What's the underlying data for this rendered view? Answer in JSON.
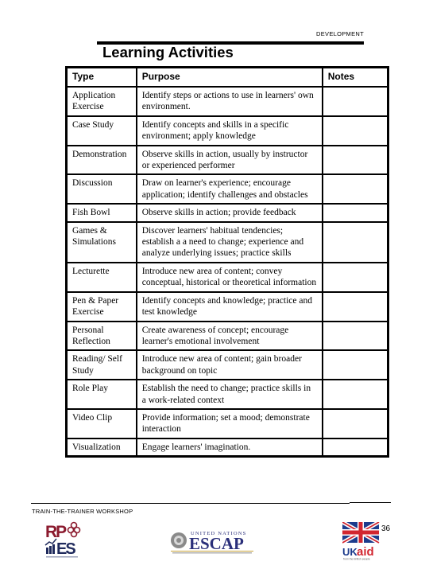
{
  "header": {
    "section_label": "DEVELOPMENT",
    "title": "Learning Activities"
  },
  "table": {
    "columns": [
      "Type",
      "Purpose",
      "Notes"
    ],
    "rows": [
      {
        "type": "Application Exercise",
        "purpose": "Identify steps or actions to use in learners' own environment.",
        "notes": ""
      },
      {
        "type": "Case Study",
        "purpose": "Identify concepts and skills in a specific environment; apply knowledge",
        "notes": ""
      },
      {
        "type": "Demonstration",
        "purpose": "Observe skills in action, usually by instructor or experienced performer",
        "notes": ""
      },
      {
        "type": "Discussion",
        "purpose": "Draw on learner's experience; encourage application; identify challenges and obstacles",
        "notes": ""
      },
      {
        "type": "Fish Bowl",
        "purpose": "Observe skills in action; provide feedback",
        "notes": ""
      },
      {
        "type": "Games & Simulations",
        "purpose": "Discover learners' habitual tendencies; establish a a need to change; experience and analyze underlying issues; practice skills",
        "notes": ""
      },
      {
        "type": "Lecturette",
        "purpose": "Introduce new area of content; convey conceptual, historical or theoretical information",
        "notes": ""
      },
      {
        "type": "Pen & Paper Exercise",
        "purpose": "Identify concepts and knowledge; practice and test knowledge",
        "notes": ""
      },
      {
        "type": "Personal Reflection",
        "purpose": "Create awareness of concept; encourage learner's emotional involvement",
        "notes": ""
      },
      {
        "type": "Reading/ Self Study",
        "purpose": "Introduce new area of content; gain broader background on topic",
        "notes": ""
      },
      {
        "type": "Role Play",
        "purpose": "Establish the need to change; practice skills in a work-related context",
        "notes": ""
      },
      {
        "type": "Video Clip",
        "purpose": "Provide information; set a mood; demonstrate interaction",
        "notes": ""
      },
      {
        "type": "Visualization",
        "purpose": "Engage learners' imagination.",
        "notes": ""
      }
    ]
  },
  "footer": {
    "label": "TRAIN-THE-TRAINER WORKSHOP",
    "page_number": "36",
    "logos": {
      "rpes": {
        "name": "rpes-logo",
        "text_top": "RP",
        "text_bottom": "ES",
        "colors": {
          "maroon": "#8b1a2e",
          "navy": "#1f2a5c"
        }
      },
      "escap": {
        "name": "un-escap-logo",
        "text_top": "UNITED NATIONS",
        "text_main": "ESCAP",
        "colors": {
          "navy": "#2a2f7a",
          "gold": "#c9a43a",
          "grey": "#888888"
        }
      },
      "ukaid": {
        "name": "ukaid-logo",
        "text_uk": "UK",
        "text_aid": "aid",
        "tagline": "from the British people",
        "colors": {
          "blue": "#1d3c8c",
          "red": "#d22630"
        }
      }
    }
  }
}
